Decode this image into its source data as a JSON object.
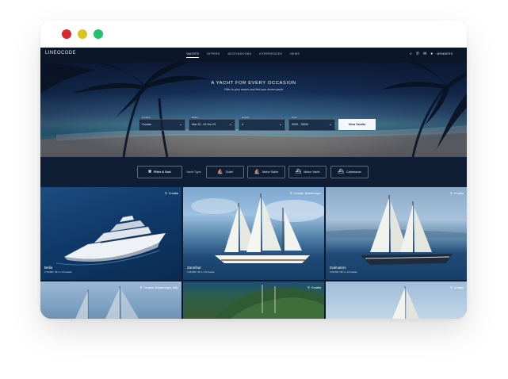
{
  "window": {
    "dots": [
      "#d9262f",
      "#d7c520",
      "#1fc16b"
    ]
  },
  "nav": {
    "logo": "LINEOCODE",
    "items": [
      {
        "label": "YACHTS",
        "active": true
      },
      {
        "label": "OFFERS"
      },
      {
        "label": "DESTINATIONS"
      },
      {
        "label": "EXPERIENCES"
      },
      {
        "label": "NEWS"
      }
    ],
    "icons": [
      "search-icon",
      "phone-icon",
      "mail-icon",
      "user-icon"
    ],
    "members_label": "MEMBERS"
  },
  "hero": {
    "title": "A YACHT FOR EVERY OCCASION",
    "subtitle": "Filter to your search and find your dream yacht",
    "fields": [
      {
        "label": "Location",
        "value": "Croatia"
      },
      {
        "label": "Dates",
        "value": "Mar 20 - 03 Jun 23"
      },
      {
        "label": "Guests",
        "value": "4"
      },
      {
        "label": "Price",
        "value": "5000 - 75000"
      }
    ],
    "button": "View Yachts"
  },
  "filters": {
    "sort_label": "Filter & Sort",
    "type_label": "Yacht Type",
    "types": [
      "Gulet",
      "Motor Sailer",
      "Motor Yacht",
      "Catamaran"
    ]
  },
  "cards": [
    {
      "location": "Croatia",
      "name": "Bella",
      "meta": "4 70,000 / 40 m / 12 Guests"
    },
    {
      "location": "Croatia, Montenegro",
      "name": "Zanzibar",
      "meta": "4 66,000 / 40 m / 12 Guests"
    },
    {
      "location": "Croatia",
      "name": "Dalmatino",
      "meta": "4 60,000 / 48 m / 12 Guests"
    },
    {
      "location": "Croatia, Montenegro, Italy",
      "name": "",
      "meta": ""
    },
    {
      "location": "Croatia",
      "name": "",
      "meta": ""
    },
    {
      "location": "Croatia",
      "name": "",
      "meta": ""
    }
  ]
}
